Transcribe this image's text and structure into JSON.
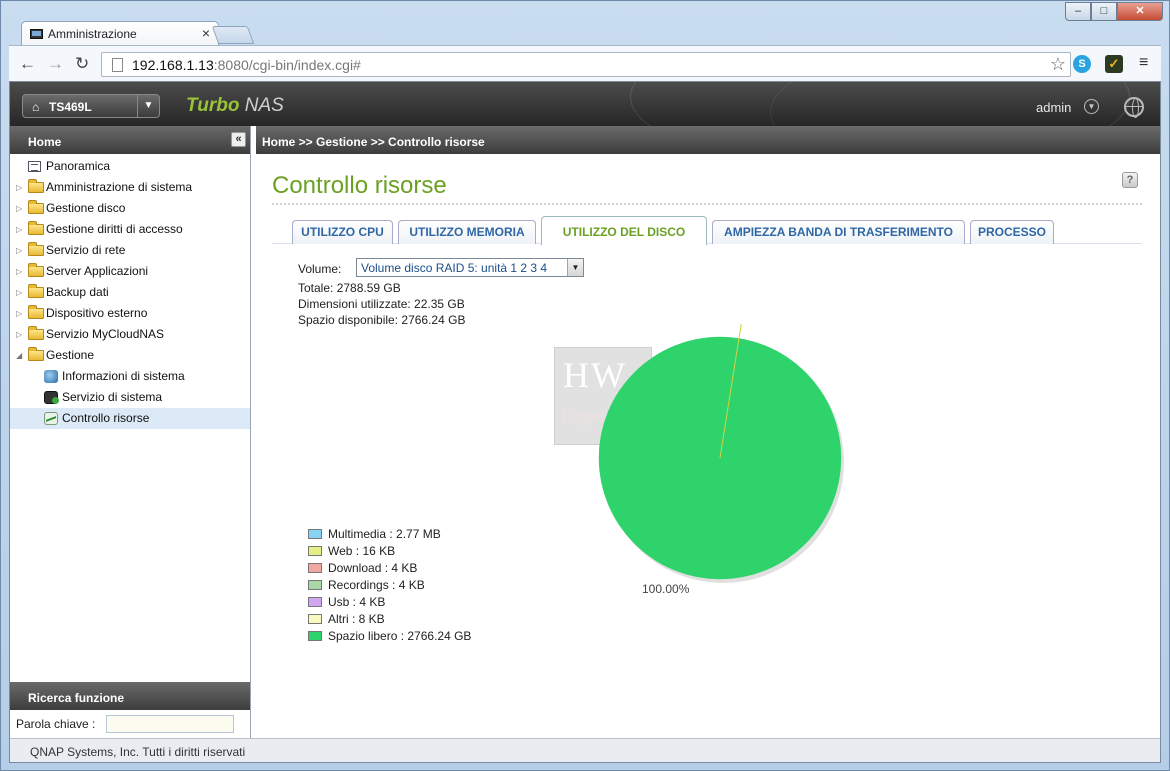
{
  "browser": {
    "tab_title": "Amministrazione",
    "tab_close": "×",
    "url_host": "192.168.1.13",
    "url_rest": ":8080/cgi-bin/index.cgi#",
    "back": "←",
    "forward": "→",
    "reload": "↻",
    "star": "☆",
    "menu": "≡",
    "win_min": "–",
    "win_max": "□",
    "win_close": "✕"
  },
  "header": {
    "server_name": "TS469L",
    "brand_turbo": "Turbo",
    "brand_nas": " NAS",
    "user": "admin"
  },
  "left_panel": {
    "title": "Home",
    "collapse": "«",
    "items": [
      {
        "label": "Panoramica"
      },
      {
        "label": "Amministrazione di sistema"
      },
      {
        "label": "Gestione disco"
      },
      {
        "label": "Gestione diritti di accesso"
      },
      {
        "label": "Servizio di rete"
      },
      {
        "label": "Server Applicazioni"
      },
      {
        "label": "Backup dati"
      },
      {
        "label": "Dispositivo esterno"
      },
      {
        "label": "Servizio MyCloudNAS"
      },
      {
        "label": "Gestione"
      }
    ],
    "sub_items": [
      {
        "label": "Informazioni di sistema"
      },
      {
        "label": "Servizio di sistema"
      },
      {
        "label": "Controllo risorse"
      }
    ],
    "search_title": "Ricerca funzione",
    "search_label": "Parola chiave :"
  },
  "breadcrumb": "Home >> Gestione >> Controllo risorse",
  "main": {
    "title": "Controllo risorse",
    "help": "?",
    "tabs": [
      {
        "label": "UTILIZZO CPU"
      },
      {
        "label": "UTILIZZO MEMORIA"
      },
      {
        "label": "UTILIZZO DEL DISCO"
      },
      {
        "label": "AMPIEZZA BANDA DI TRASFERIMENTO"
      },
      {
        "label": "PROCESSO"
      }
    ],
    "volume_label": "Volume:",
    "volume_value": "Volume disco RAID 5: unità 1 2 3 4",
    "total": "Totale: 2788.59 GB",
    "used": "Dimensioni utilizzate: 22.35 GB",
    "free": "Spazio disponibile: 2766.24 GB",
    "watermark_top": "HW",
    "watermark_bottom": "Legend"
  },
  "chart_data": {
    "type": "pie",
    "categories": [
      "Multimedia",
      "Web",
      "Download",
      "Recordings",
      "Usb",
      "Altri",
      "Spazio libero"
    ],
    "labels": [
      "Multimedia : 2.77 MB",
      "Web : 16 KB",
      "Download : 4 KB",
      "Recordings : 4 KB",
      "Usb : 4 KB",
      "Altri : 8 KB",
      "Spazio libero : 2766.24 GB"
    ],
    "values_gb": [
      0.00277,
      1.6e-05,
      4e-06,
      4e-06,
      4e-06,
      8e-06,
      2766.24
    ],
    "colors": [
      "#86d3f5",
      "#e5ef8a",
      "#f2a7a2",
      "#a8d8a8",
      "#d3a4f2",
      "#fafac0",
      "#2fd36b"
    ],
    "slice_label": "100.00%"
  },
  "footer": "QNAP Systems, Inc. Tutti i diritti riservati"
}
